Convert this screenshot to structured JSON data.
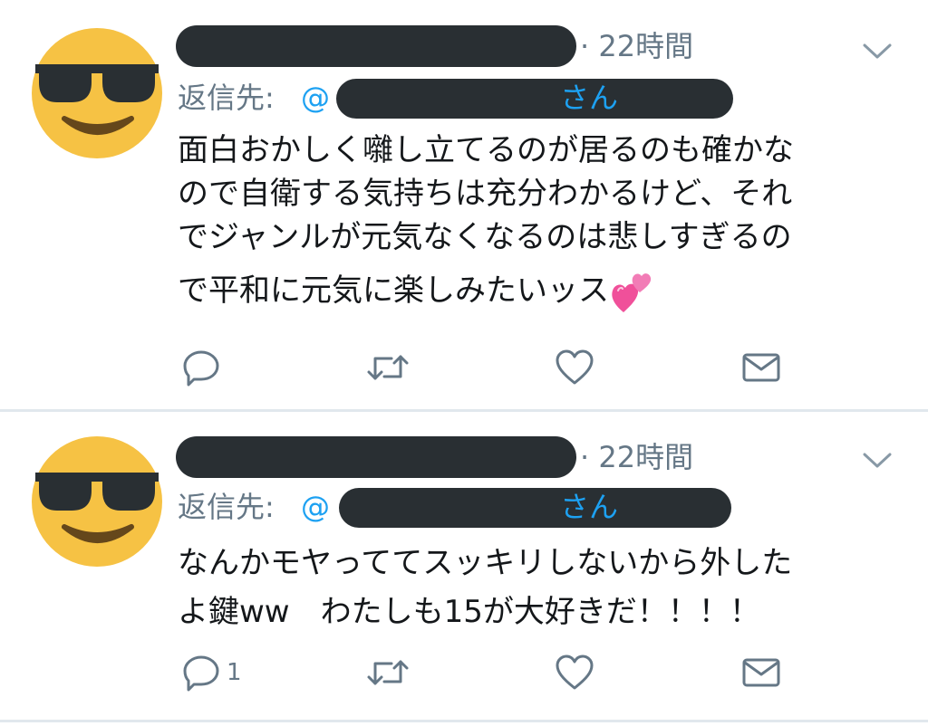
{
  "colors": {
    "secondary_text": "#657786",
    "link": "#1da1f2",
    "primary_text": "#14171a",
    "redaction": "#292f33",
    "divider": "#e1e8ed",
    "avatar_face": "#f6c244"
  },
  "tweets": [
    {
      "avatar_icon": "sunglasses-face-emoji",
      "name": "",
      "timestamp": "· 22時間",
      "menu_icon": "chevron-down-icon",
      "reply_prefix": "返信先:",
      "reply_at": "@",
      "reply_suffix": "さん",
      "text_lines": [
        "面白おかしく囃し立てるのが居るのも確かな",
        "ので自衛する気持ちは充分わかるけど、それ",
        "でジャンルが元気なくなるのは悲しすぎるの",
        "で平和に元気に楽しみたいッス"
      ],
      "emoji": "two-hearts-emoji",
      "actions": {
        "reply_count": "",
        "retweet_count": "",
        "like_count": ""
      }
    },
    {
      "avatar_icon": "sunglasses-face-emoji",
      "name": "",
      "timestamp": "· 22時間",
      "menu_icon": "chevron-down-icon",
      "reply_prefix": "返信先:",
      "reply_at": "@",
      "reply_suffix": "さん",
      "text_lines": [
        "なんかモヤっててスッキリしないから外した",
        "よ鍵ww　わたしも15が大好きだ！！！！"
      ],
      "actions": {
        "reply_count": "1",
        "retweet_count": "",
        "like_count": ""
      }
    }
  ]
}
